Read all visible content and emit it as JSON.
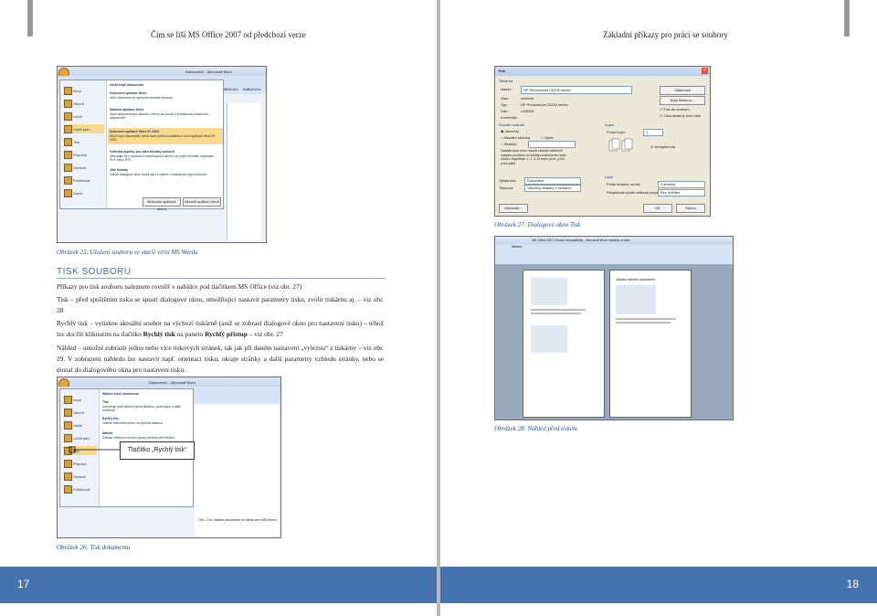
{
  "left_page": {
    "header": "Čím se liší MS Office 2007 od předchozí verze",
    "screenshot1": {
      "title_bar": "Dokument1 - Microsoft Word",
      "menu_items": [
        "Nový",
        "Otevřít",
        "Uložit",
        "Uložit jako",
        "Tisk",
        "Připravit",
        "Odeslat",
        "Publikovat",
        "Zavřít"
      ],
      "submenu_heading": "Uložit kopii dokumentu",
      "submenu": [
        {
          "title": "Dokument aplikace Word",
          "desc": "Uloží dokument ve výchozím formátu souboru."
        },
        {
          "title": "Šablona aplikace Word",
          "desc": "Uloží dokument jako šablonu, kterou lze použít k formátování budoucích dokumentů."
        },
        {
          "title": "Dokument aplikace Word 97-2003",
          "desc": "Uloží kopii dokumentu, která bude plně kompatibilní s verzí aplikace Word 97-2003."
        },
        {
          "title": "Vyhledat doplňky pro další formáty souborů",
          "desc": "Informujte se o doplňcích umožňujících uložení do jiných formátů, například PDF nebo XPS."
        },
        {
          "title": "Jiné formáty",
          "desc": "Otevře dialogové okno Uložit jako a vybere z dostupných typů souborů."
        }
      ],
      "styles": [
        "AaBbCcDc",
        "AaBbCcDc"
      ],
      "buttons": [
        "Možnosti aplikace Word",
        "Ukončit aplikaci Word"
      ]
    },
    "caption1": "Obrázek 25: Uložení souboru ve starší verzi MS Wordu",
    "section_title": "TISK SOUBORU",
    "paragraphs": {
      "p1": "Příkazy pro tisk souboru naleznete rovněž v nabídce pod tlačítkem MS Office (viz obr. 27)",
      "p2": "Tisk – před spuštěním tisku se spustí dialogové okno, umožňující nastavit parametry tisku, zvolit tiskárnu aj. – viz obr. 28",
      "p3_a": "Rychlý tisk – vytiskne aktuální soubor na výchozí tiskárně (aniž se zobrazí dialogové okno pro nastavení tisku) – téhož lze docílit kliknutím na tlačítko ",
      "p3_b": "Rychlý tisk",
      "p3_c": " na panelu ",
      "p3_d": "Rychlý přístup",
      "p3_e": " – viz obr. 27",
      "p4": "Náhled – umožní zobrazit jednu nebo více tiskových stránek, tak jak při daném nastavení „vylezou“ z tiskárny – viz obr. 29. V zobrazení náhledu lze nastavit např. orientaci tisku, okraje stránky a další parametry vzhledu stránky, nebo se dostat do dialogového okna pro nastavení tisku."
    },
    "screenshot2": {
      "title_bar": "Dokument1 - Microsoft Word",
      "submenu_heading": "Náhled a tisk dokumentu",
      "submenu": [
        {
          "title": "Tisk",
          "desc": "Umožňuje před tiskem vybrat tiskárnu, počet kopií a další možnosti."
        },
        {
          "title": "Rychlý tisk",
          "desc": "Odešle dokument přímo na výchozí tiskárnu."
        },
        {
          "title": "Náhled",
          "desc": "Zobrazí náhled a umožní úpravy stránek před tiskem."
        }
      ],
      "doc_caption": "Obr. 2.2a: Ukázka dokumentu ve starší verzi MS Wordu"
    },
    "callout": "Tlačítko „Rychlý tisk“",
    "caption2": "Obrázek 26: Tisk dokumentu",
    "page_number": "17"
  },
  "right_page": {
    "header": "Základní příkazy pro práci se soubory",
    "print_dialog": {
      "title": "Tisk",
      "printer_group": "Tiskárna",
      "name_label": "Název:",
      "printer_name": "HP Photosmart C5100 series",
      "status_label": "Stav:",
      "status_value": "nečinná",
      "type_label": "Typ:",
      "type_value": "HP Photosmart C5100 series",
      "where_label": "Kde:",
      "where_value": "USB001",
      "comment_label": "Komentář:",
      "btn_properties": "Vlastnosti",
      "btn_find": "Najít tiskárnu...",
      "chk_tofile": "Tisk do souboru",
      "chk_duplex": "Oboustranný ruční tisk",
      "range_group": "Rozsah stránek",
      "range_all": "Všechny",
      "range_current": "Aktuální stránka",
      "range_selection": "Výběr",
      "range_pages": "Stránky:",
      "range_hint": "Zadejte čísla nebo rozsah stránek oddělené čárkami počítáno od začátku dokumentu nebo oddílu. Například: 1, 3, 5-12 nebo p1s1, p1s2, p1s3-p8s3",
      "copies_group": "Kopie",
      "copies_label": "Počet kopií:",
      "copies_value": "1",
      "collate": "Kompletovat",
      "print_what_label": "Vytisknout:",
      "print_what_value": "Dokument",
      "print_label": "Tisknout:",
      "print_value": "Všechny stránky v rozsahu",
      "zoom_group": "Lupa",
      "pages_per_sheet_label": "Počet stránek na list:",
      "pages_per_sheet_value": "1 stránky",
      "scale_label": "Přizpůsobit podle velikosti papíru:",
      "scale_value": "Bez měřítka",
      "btn_options": "Možnosti...",
      "btn_ok": "OK",
      "btn_cancel": "Storno"
    },
    "caption_dialog": "Obrázek 27: Dialogové okno Tisk",
    "preview_shot": {
      "title_bar": "MS Office 2007 Úvodní kompatibility - Microsoft Word náhledu a tisku",
      "tab": "Náhled",
      "page_heading": "Ukázka náhledu dokumentu"
    },
    "caption_preview": "Obrázek 28: Náhled před tiskem",
    "page_number": "18"
  }
}
